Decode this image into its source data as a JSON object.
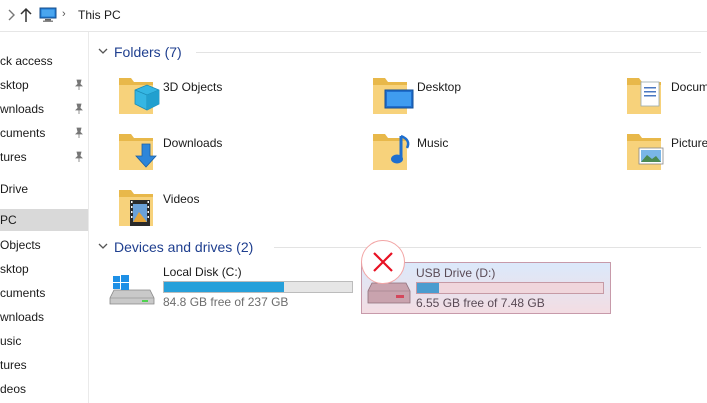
{
  "address_bar": {
    "crumb": "This PC",
    "separator": "›"
  },
  "sidebar": {
    "items": [
      {
        "label": "ck access",
        "pinned": false,
        "selected": false
      },
      {
        "label": "sktop",
        "pinned": true,
        "selected": false
      },
      {
        "label": "wnloads",
        "pinned": true,
        "selected": false
      },
      {
        "label": "cuments",
        "pinned": true,
        "selected": false
      },
      {
        "label": "tures",
        "pinned": true,
        "selected": false
      },
      {
        "label": "Drive",
        "pinned": false,
        "selected": false
      },
      {
        "label": "PC",
        "pinned": false,
        "selected": true
      },
      {
        "label": "Objects",
        "pinned": false,
        "selected": false
      },
      {
        "label": "sktop",
        "pinned": false,
        "selected": false
      },
      {
        "label": "cuments",
        "pinned": false,
        "selected": false
      },
      {
        "label": "wnloads",
        "pinned": false,
        "selected": false
      },
      {
        "label": "usic",
        "pinned": false,
        "selected": false
      },
      {
        "label": "tures",
        "pinned": false,
        "selected": false
      },
      {
        "label": "deos",
        "pinned": false,
        "selected": false
      }
    ]
  },
  "folders_section": {
    "title": "Folders (7)",
    "items": [
      {
        "label": "3D Objects",
        "icon": "3d-objects-folder-icon"
      },
      {
        "label": "Desktop",
        "icon": "desktop-folder-icon"
      },
      {
        "label": "Docum",
        "icon": "documents-folder-icon"
      },
      {
        "label": "Downloads",
        "icon": "downloads-folder-icon"
      },
      {
        "label": "Music",
        "icon": "music-folder-icon"
      },
      {
        "label": "Picture",
        "icon": "pictures-folder-icon"
      },
      {
        "label": "Videos",
        "icon": "videos-folder-icon"
      }
    ]
  },
  "drives_section": {
    "title": "Devices and drives (2)",
    "drives": [
      {
        "name": "Local Disk (C:)",
        "free": "84.8 GB free of 237 GB",
        "used_fraction": 0.64,
        "icon": "windows-drive-icon"
      },
      {
        "name": "USB Drive (D:)",
        "free": "6.55 GB free of 7.48 GB",
        "used_fraction": 0.12,
        "icon": "usb-drive-icon",
        "error": true
      }
    ]
  },
  "colors": {
    "accent": "#1f3f8f",
    "usage_bar": "#26a0da",
    "error": "#e81123"
  }
}
